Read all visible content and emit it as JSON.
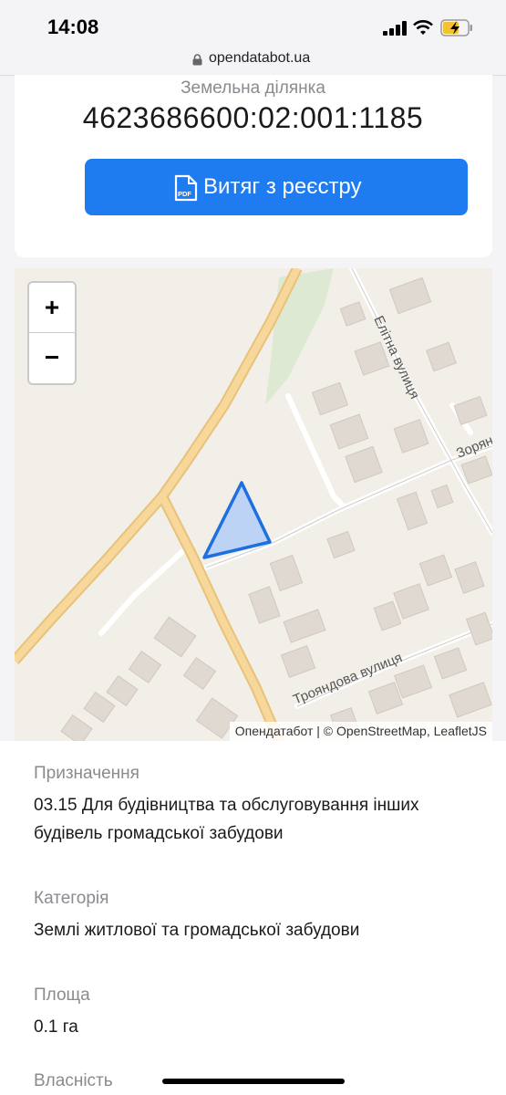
{
  "status": {
    "time": "14:08"
  },
  "browser": {
    "url": "opendatabot.ua"
  },
  "parcel": {
    "type_label": "Земельна ділянка",
    "cadastral_number": "4623686600:02:001:1185",
    "button_label": "Витяг з реєстру",
    "button_icon_text": "PDF"
  },
  "map": {
    "zoom_in": "+",
    "zoom_out": "−",
    "streets": {
      "elitna": "Елітна вулиця",
      "troyandova": "Трояндова вулиця",
      "zoriana": "Зоряна"
    },
    "attribution": "Опендатабот | © OpenStreetMap, LeafletJS",
    "colors": {
      "parcel_fill": "#bcd3f5",
      "parcel_stroke": "#1e6fe0",
      "road": "#f3d08e"
    }
  },
  "details": {
    "purpose_label": "Призначення",
    "purpose_value": "03.15 Для будівництва та обслуговування інших будівель громадської забудови",
    "category_label": "Категорія",
    "category_value": "Землі житлової та громадської забудови",
    "area_label": "Площа",
    "area_value": "0.1 га",
    "ownership_label": "Власність"
  }
}
